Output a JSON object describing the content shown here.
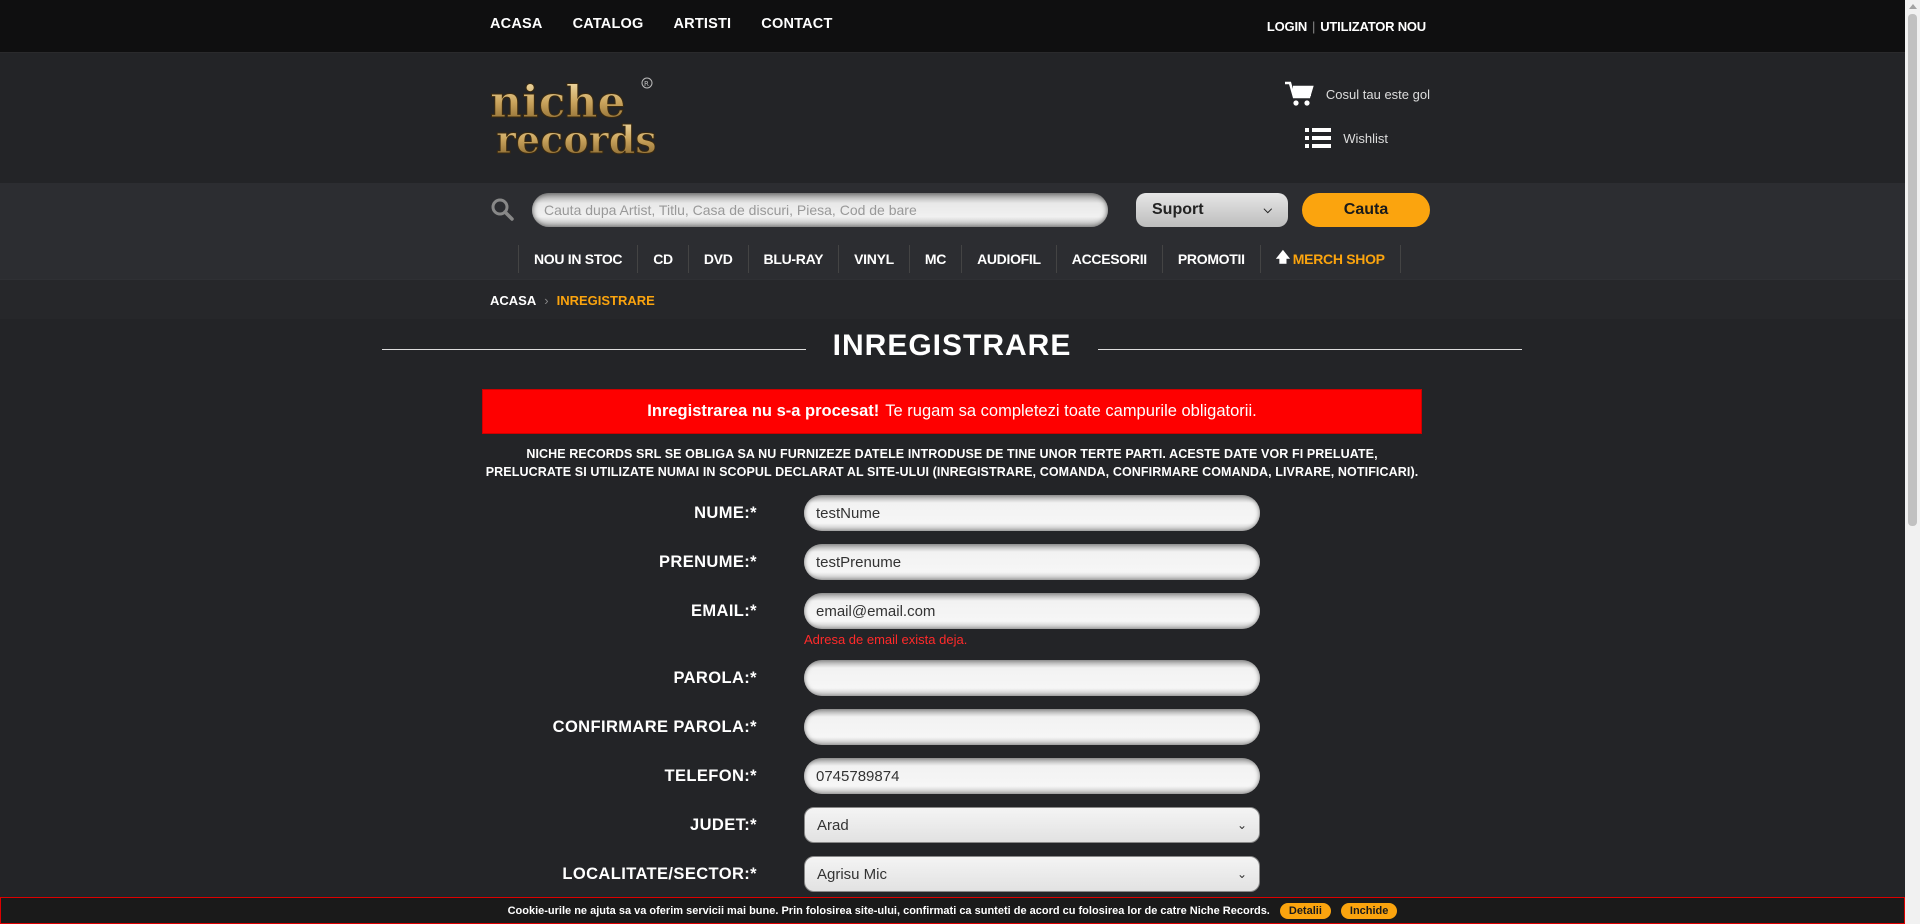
{
  "topnav": {
    "items": [
      "ACASA",
      "CATALOG",
      "ARTISTI",
      "CONTACT"
    ]
  },
  "toplinks": {
    "login": "LOGIN",
    "register": "UTILIZATOR NOU"
  },
  "header": {
    "logo_text": "niche records",
    "cart_text": "Cosul tau este gol",
    "wishlist_text": "Wishlist"
  },
  "search": {
    "placeholder": "Cauta dupa Artist, Titlu, Casa de discuri, Piesa, Cod de bare",
    "suport_value": "Suport",
    "button_label": "Cauta"
  },
  "categories": [
    "NOU IN STOC",
    "CD",
    "DVD",
    "BLU-RAY",
    "VINYL",
    "MC",
    "AUDIOFIL",
    "ACCESORII",
    "PROMOTII",
    "MERCH SHOP"
  ],
  "breadcrumb": {
    "home": "ACASA",
    "current": "INREGISTRARE"
  },
  "page_title": "INREGISTRARE",
  "error": {
    "bold": "Inregistrarea nu s-a procesat!",
    "text": "Te rugam sa completezi toate campurile obligatorii."
  },
  "notice": "NICHE RECORDS SRL SE OBLIGA SA NU FURNIZEZE DATELE INTRODUSE DE TINE UNOR TERTE PARTI. ACESTE DATE VOR FI PRELUATE, PRELUCRATE SI UTILIZATE NUMAI IN SCOPUL DECLARAT AL SITE-ULUI (INREGISTRARE, COMANDA, CONFIRMARE COMANDA, LIVRARE, NOTIFICARI).",
  "form": {
    "nume": {
      "label": "NUME:*",
      "value": "testNume"
    },
    "prenume": {
      "label": "PRENUME:*",
      "value": "testPrenume"
    },
    "email": {
      "label": "EMAIL:*",
      "value": "email@email.com",
      "error": "Adresa de email exista deja."
    },
    "parola": {
      "label": "PAROLA:*",
      "value": ""
    },
    "confirmare": {
      "label": "CONFIRMARE PAROLA:*",
      "value": ""
    },
    "telefon": {
      "label": "TELEFON:*",
      "value": "0745789874"
    },
    "judet": {
      "label": "JUDET:*",
      "value": "Arad"
    },
    "localitate": {
      "label": "LOCALITATE/SECTOR:*",
      "value": "Agrisu Mic"
    }
  },
  "cookie": {
    "text": "Cookie-urile ne ajuta sa va oferim servicii mai bune. Prin folosirea site-ului, confirmati ca sunteti de acord cu folosirea lor de catre Niche Records.",
    "details": "Detalii",
    "close": "Inchide"
  },
  "colors": {
    "accent": "#fba40e",
    "error": "#fe0000",
    "background": "#232427"
  }
}
